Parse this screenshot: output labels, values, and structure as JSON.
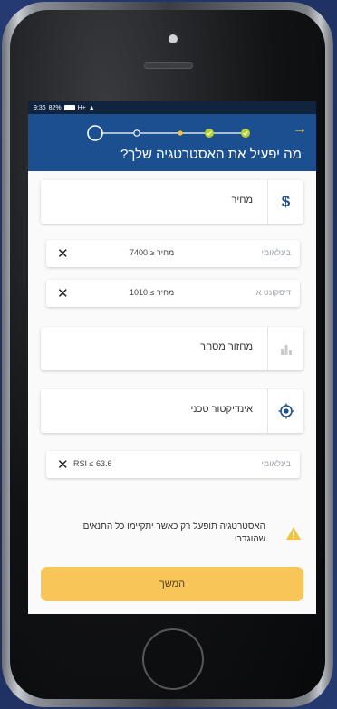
{
  "status_bar": {
    "time": "9:36",
    "battery": "82%",
    "network": "H+"
  },
  "header": {
    "title": "מה יפעיל את האסטרטגיה שלך?"
  },
  "categories": {
    "price": {
      "label": "מחיר"
    },
    "volume": {
      "label": "מחזור מסחר"
    },
    "technical": {
      "label": "אינדיקטור טכני"
    }
  },
  "conditions": [
    {
      "text": "מחיר ≤ 7400",
      "source": "בינלאומי"
    },
    {
      "text": "מחיר ≥ 1010",
      "source": "דיסקונט א"
    },
    {
      "text": "RSI      ≤ 63.6",
      "source": "בינלאומי"
    }
  ],
  "notice": {
    "text": "האסטרטגיה תופעל רק כאשר יתקיימו כל התנאים שהוגדרו"
  },
  "continue_button": {
    "label": "המשך"
  },
  "colors": {
    "header": "#1b4f8f",
    "accent": "#f5c33b",
    "button": "#f7c558",
    "check": "#b7d12f"
  }
}
